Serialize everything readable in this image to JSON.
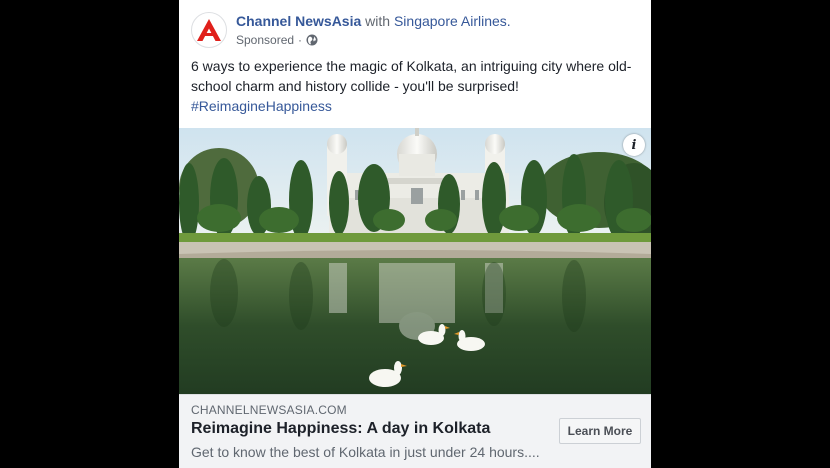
{
  "header": {
    "page_name": "Channel NewsAsia",
    "with_word": "with",
    "partner_name": "Singapore Airlines.",
    "sponsored_label": "Sponsored",
    "separator": "·",
    "privacy_icon": "globe-icon",
    "avatar_icon": "cna-logo-icon"
  },
  "post": {
    "text": "6 ways to experience the magic of Kolkata, an intriguing city where old-school charm and history collide - you'll be surprised!",
    "hashtag": "#ReimagineHappiness"
  },
  "media": {
    "info_label": "i",
    "info_icon": "info-icon"
  },
  "link": {
    "domain": "CHANNELNEWSASIA.COM",
    "title": "Reimagine Happiness: A day in Kolkata",
    "description": "Get to know the best of Kolkata in just under 24 hours....",
    "cta_label": "Learn More"
  },
  "colors": {
    "brand_red": "#e0201b",
    "link_blue": "#365899",
    "page_background": "#000000",
    "card_background": "#ffffff",
    "link_box_background": "#f2f3f5"
  }
}
